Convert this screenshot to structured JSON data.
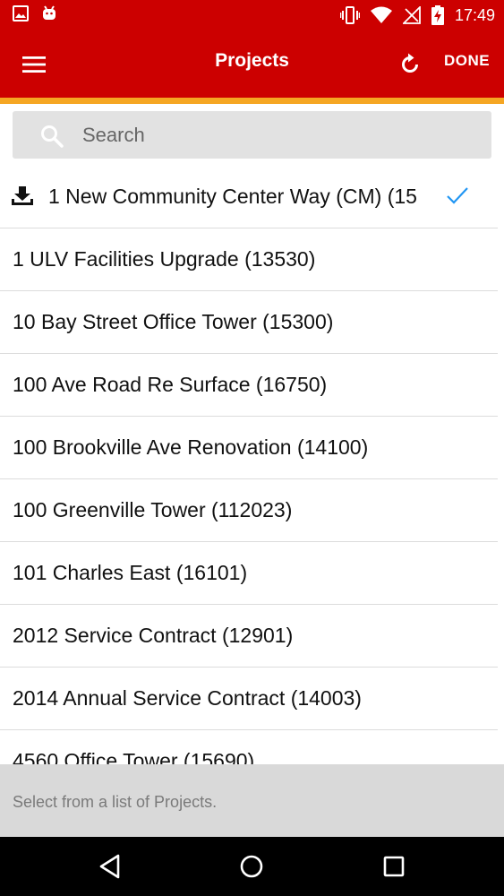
{
  "status_bar": {
    "time": "17:49",
    "icons": [
      "image-icon",
      "android-icon",
      "vibrate-icon",
      "wifi-icon",
      "no-signal-icon",
      "battery-charging-icon"
    ]
  },
  "app_bar": {
    "title": "Projects",
    "done_label": "DONE",
    "icons": [
      "menu-icon",
      "refresh-icon"
    ],
    "accent_color": "#f5a623",
    "bar_color": "#cc0000"
  },
  "search": {
    "placeholder": "Search",
    "value": ""
  },
  "projects": [
    {
      "label": "1 New Community Center Way (CM) (15",
      "downloaded": true,
      "selected": true
    },
    {
      "label": "1 ULV Facilities Upgrade (13530)"
    },
    {
      "label": "10 Bay Street Office Tower (15300)"
    },
    {
      "label": "100 Ave Road Re Surface (16750)"
    },
    {
      "label": "100 Brookville Ave Renovation (14100)"
    },
    {
      "label": "100 Greenville Tower (112023)"
    },
    {
      "label": "101 Charles East (16101)"
    },
    {
      "label": "2012 Service Contract (12901)"
    },
    {
      "label": "2014 Annual Service Contract (14003)"
    },
    {
      "label": "4560 Office Tower (15690)"
    }
  ],
  "footer": {
    "hint": "Select from a list of Projects."
  },
  "nav_bar": {
    "icons": [
      "back-icon",
      "home-icon",
      "recents-icon"
    ]
  }
}
